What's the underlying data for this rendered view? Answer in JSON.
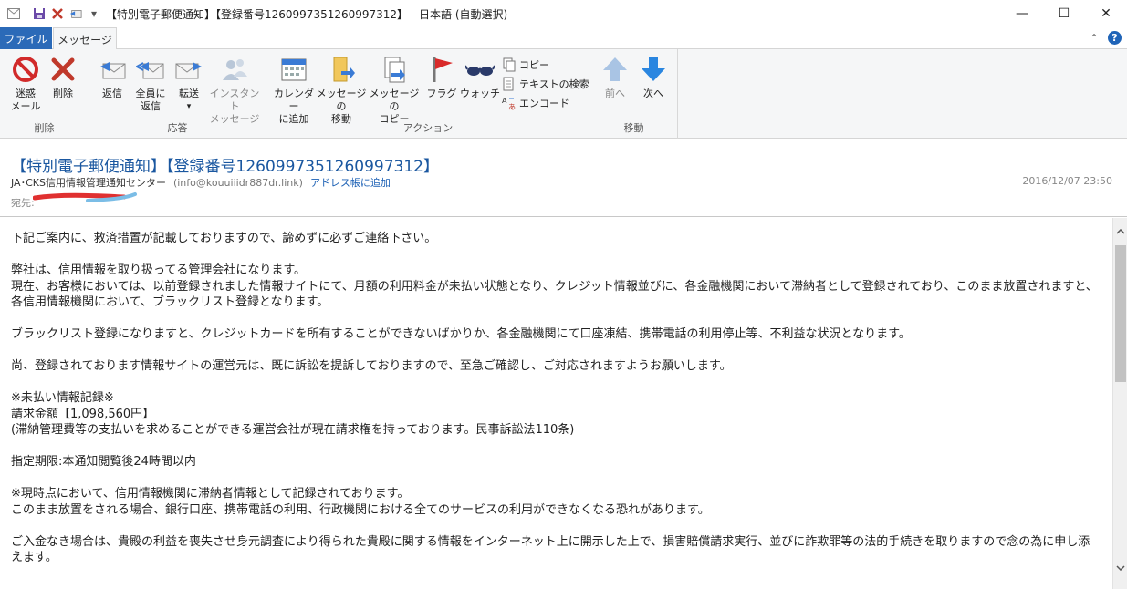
{
  "window": {
    "title": "【特別電子郵便通知】【登録番号1260997351260997312】 - 日本語 (自動選択)",
    "controls": {
      "minimize": "—",
      "maximize": "☐",
      "close": "✕"
    }
  },
  "tabs": {
    "file": "ファイル",
    "message": "メッセージ"
  },
  "ribbon": {
    "groups": {
      "delete": {
        "label": "削除",
        "junk": "迷惑\nメール",
        "delete": "削除"
      },
      "respond": {
        "label": "応答",
        "reply": "返信",
        "reply_all": "全員に\n返信",
        "forward": "転送",
        "im": "インスタント\nメッセージ"
      },
      "actions": {
        "label": "アクション",
        "calendar": "カレンダー\nに追加",
        "move": "メッセージの\n移動",
        "copy_msg": "メッセージの\nコピー",
        "flag": "フラグ",
        "watch": "ウォッチ",
        "copy": "コピー",
        "find": "テキストの検索",
        "encode": "エンコード"
      },
      "move": {
        "label": "移動",
        "prev": "前へ",
        "next": "次へ"
      }
    }
  },
  "message": {
    "subject": "【特別電子郵便通知】【登録番号1260997351260997312】",
    "sender_name": "JA･CKS信用情報管理通知センター",
    "sender_address": "(info@kouuiiidr887dr.link)",
    "add_contact": "アドレス帳に追加",
    "date": "2016/12/07 23:50",
    "to_label": "宛先:"
  },
  "body": {
    "line1": "下記ご案内に、救済措置が記載しておりますので、諦めずに必ずご連絡下さい。",
    "line2": "弊社は、信用情報を取り扱ってる管理会社になります。",
    "line3": "現在、お客様においては、以前登録されました情報サイトにて、月額の利用料金が未払い状態となり、クレジット情報並びに、各金融機関において滞納者として登録されており、このまま放置されますと、各信用情報機関において、ブラックリスト登録となります。",
    "line4": "ブラックリスト登録になりますと、クレジットカードを所有することができないばかりか、各金融機関にて口座凍結、携帯電話の利用停止等、不利益な状況となります。",
    "line5": "尚、登録されております情報サイトの運営元は、既に訴訟を提訴しておりますので、至急ご確認し、ご対応されますようお願いします。",
    "line6": "※未払い情報記録※",
    "line7": "請求金額【1,098,560円】",
    "line8": "(滞納管理費等の支払いを求めることができる運営会社が現在請求権を持っております。民事訴訟法110条)",
    "line9": "指定期限:本通知閲覧後24時間以内",
    "line10": "※現時点において、信用情報機関に滞納者情報として記録されております。",
    "line11": "このまま放置をされる場合、銀行口座、携帯電話の利用、行政機関における全てのサービスの利用ができなくなる恐れがあります。",
    "line12": "ご入金なき場合は、貴殿の利益を喪失させ身元調査により得られた貴殿に関する情報をインターネット上に開示した上で、損害賠償請求実行、並びに詐欺罪等の法的手続きを取りますので念の為に申し添えます。"
  },
  "colors": {
    "file_tab": "#2b6ab8",
    "subject": "#1a57a0",
    "link": "#1a5fb4"
  }
}
